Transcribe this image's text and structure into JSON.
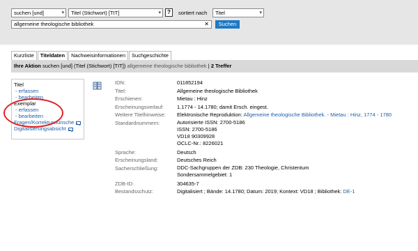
{
  "search": {
    "mode": "suchen [und]",
    "field": "Titel (Stichwort) [TIT]",
    "help": "?",
    "sort_label": "sortiert nach",
    "sort_value": "Titel",
    "query": "allgemeine theologische bibliothek",
    "clear": "✕",
    "button": "Suchen"
  },
  "tabs": [
    "Kurzliste",
    "Titeldaten",
    "Nachweisinformationen",
    "Suchgeschichte"
  ],
  "action": {
    "label": "Ihre Aktion",
    "text": "suchen [und] (Titel (Stichwort) [TIT])",
    "query": "allgemeine theologische bibliothek",
    "sep": "|",
    "count": "2 Treffer"
  },
  "sidebar": {
    "titel": "Titel",
    "titel_erfassen": "-  erfassen",
    "titel_bearbeiten": "-  bearbeiten",
    "exemplar": "Exemplar",
    "ex_erfassen": "-  erfassen",
    "ex_bearbeiten": "-  bearbeiten",
    "fragen": "Fragen/Korrekturwünsche",
    "digital": "Digitalisierungsabsicht"
  },
  "record": {
    "idn_label": "IDN:",
    "idn": "011852194",
    "titel_label": "Titel:",
    "titel": "Allgemeine theologische Bibliothek",
    "erschienen_label": "Erschienen:",
    "erschienen": "Mietau : Hinz",
    "verlauf_label": "Erscheinungsverlauf:",
    "verlauf": "1.1774 - 14.1780; damit Ersch. eingest.",
    "weitere_label": "Weitere Titelhinweise:",
    "weitere_text": "Elektronische Reproduktion:",
    "weitere_link": "Allgemeine theologische Bibliothek. - Mietau : Hinz, 1774 - 1780",
    "std_label": "Standardnummern:",
    "std": [
      "Autorisierte ISSN: 2700-5186",
      "ISSN: 2700-5186",
      "VD18 90309928",
      "OCLC-Nr.: 8226021"
    ],
    "sprache_label": "Sprache:",
    "sprache": "Deutsch",
    "land_label": "Erscheinungsland:",
    "land": "Deutsches Reich",
    "sach_label": "Sacherschließung:",
    "sach": [
      "DDC-Sachgruppen der ZDB: 230 Theologie, Christentum",
      "Sondersammelgebiet: 1"
    ],
    "zdb_label": "ZDB-ID:",
    "zdb": "304635-7",
    "bestand_label": "Bestandsschutz:",
    "bestand_text": "Digitalisiert ; Bände: 14.1780; Datum: 2019; Kontext: VD18 ; Bibliothek:",
    "bestand_link": "DE-1"
  }
}
